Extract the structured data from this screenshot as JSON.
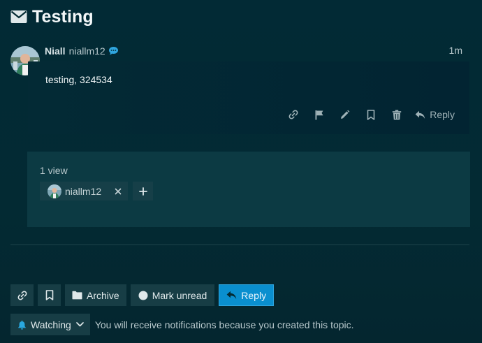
{
  "topic": {
    "title": "Testing",
    "title_icon": "envelope-icon"
  },
  "post": {
    "author_fullname": "Niall",
    "author_username": "niallm12",
    "age": "1m",
    "content": "testing, 324534",
    "actions": {
      "reply_label": "Reply"
    }
  },
  "views": {
    "count_label": "1 view",
    "viewers": [
      {
        "username": "niallm12"
      }
    ]
  },
  "footer": {
    "archive_label": "Archive",
    "mark_unread_label": "Mark unread",
    "reply_label": "Reply"
  },
  "notifications": {
    "level_label": "Watching",
    "description": "You will receive notifications because you created this topic."
  },
  "colors": {
    "background": "#032a33",
    "surface": "#173d45",
    "primary_button": "#0a8fcf",
    "muted_text": "#b8c8cc",
    "watching_bell": "#29a8e0"
  }
}
